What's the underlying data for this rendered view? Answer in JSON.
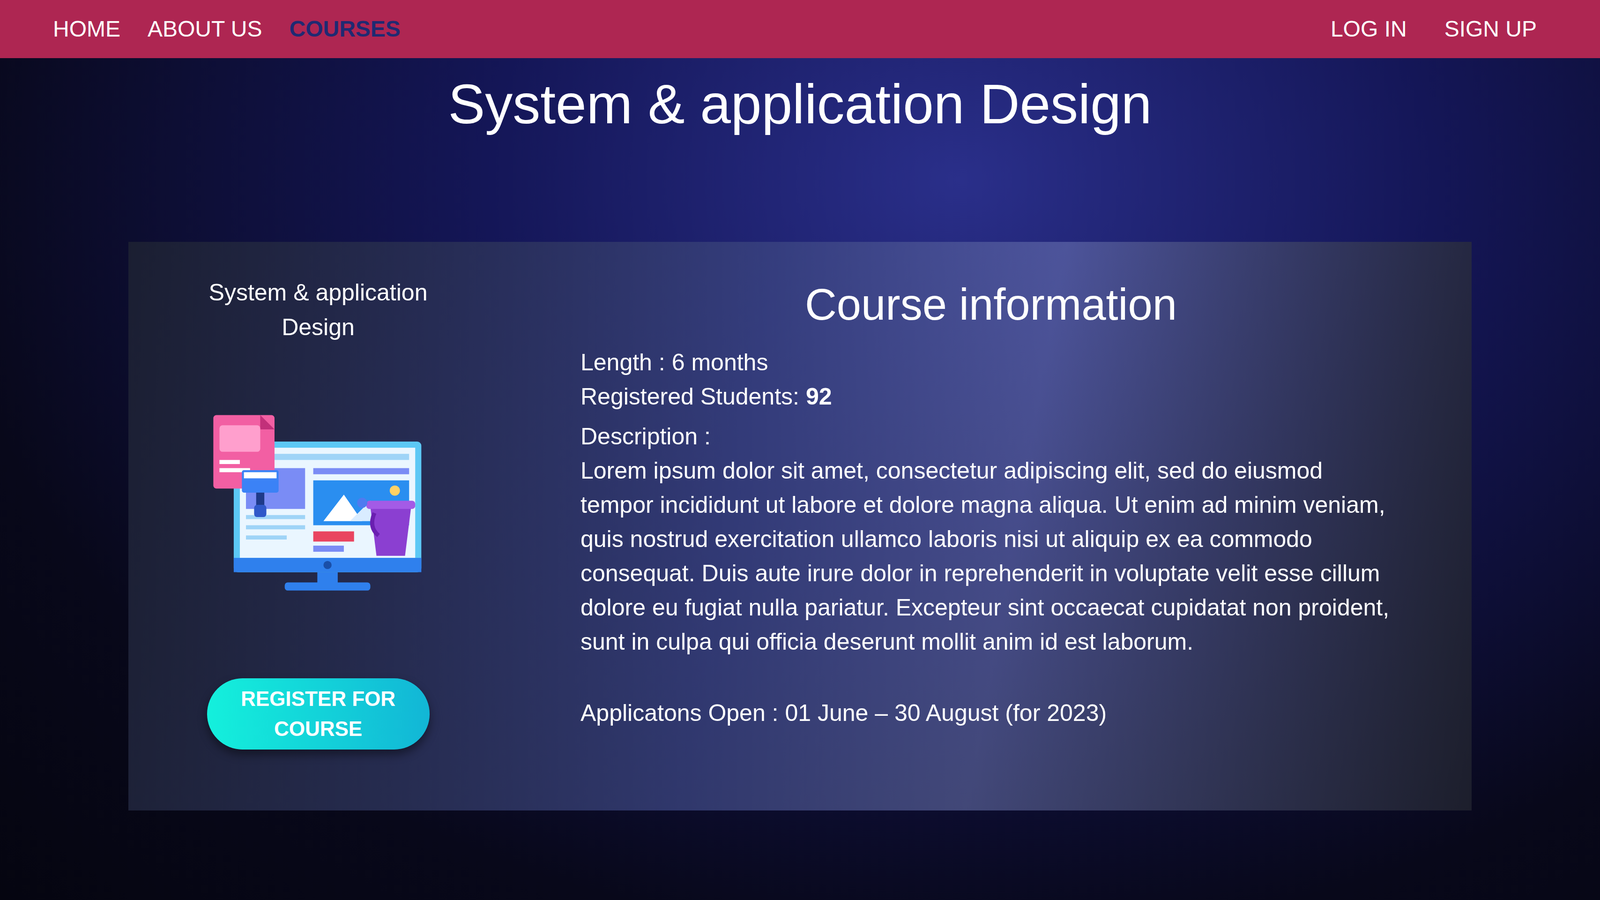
{
  "nav": {
    "left": [
      {
        "label": "HOME",
        "selected": false
      },
      {
        "label": "ABOUT US",
        "selected": false
      },
      {
        "label": "COURSES",
        "selected": true
      }
    ],
    "right": [
      {
        "label": "LOG IN"
      },
      {
        "label": "SIGN UP"
      }
    ]
  },
  "page_title": "System & application Design",
  "course_card": {
    "name": "System & application Design",
    "register_button": "REGISTER FOR COURSE",
    "info": {
      "heading": "Course information",
      "length": {
        "label": "Length :",
        "value": "6 months"
      },
      "registered": {
        "label": "Registered Students:",
        "value": "92"
      },
      "description": {
        "label": "Description :",
        "text": "Lorem ipsum dolor sit amet, consectetur adipiscing elit, sed do eiusmod tempor incididunt ut labore et dolore magna aliqua. Ut enim ad minim veniam, quis nostrud exercitation ullamco laboris nisi ut aliquip ex ea commodo consequat. Duis aute irure dolor in reprehenderit in voluptate velit esse cillum dolore eu fugiat nulla pariatur. Excepteur sint occaecat cupidatat non proident, sunt in culpa qui officia deserunt mollit anim id est laborum."
      },
      "applications": {
        "label": "Applicatons Open :",
        "value": "01 June – 30 August (for 2023)"
      }
    }
  }
}
